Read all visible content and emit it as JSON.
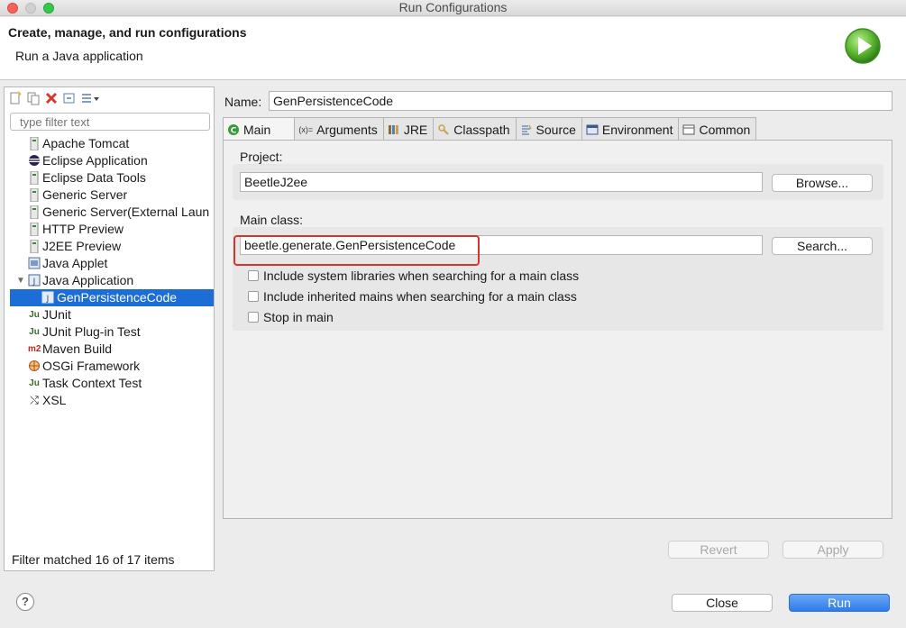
{
  "window": {
    "title": "Run Configurations"
  },
  "header": {
    "title": "Create, manage, and run configurations",
    "subtitle": "Run a Java application"
  },
  "left": {
    "filter_placeholder": "type filter text",
    "items": [
      {
        "label": "Apache Tomcat",
        "icon": "tomcat-icon"
      },
      {
        "label": "Eclipse Application",
        "icon": "eclipse-icon"
      },
      {
        "label": "Eclipse Data Tools",
        "icon": "data-tools-icon"
      },
      {
        "label": "Generic Server",
        "icon": "server-icon"
      },
      {
        "label": "Generic Server(External Laun",
        "icon": "server-icon"
      },
      {
        "label": "HTTP Preview",
        "icon": "server-icon"
      },
      {
        "label": "J2EE Preview",
        "icon": "server-icon"
      },
      {
        "label": "Java Applet",
        "icon": "applet-icon"
      },
      {
        "label": "Java Application",
        "icon": "java-app-icon"
      },
      {
        "label": "GenPersistenceCode",
        "icon": "java-app-icon"
      },
      {
        "label": "JUnit",
        "icon": "junit-icon"
      },
      {
        "label": "JUnit Plug-in Test",
        "icon": "junit-plugin-icon"
      },
      {
        "label": "Maven Build",
        "icon": "maven-icon"
      },
      {
        "label": "OSGi Framework",
        "icon": "osgi-icon"
      },
      {
        "label": "Task Context Test",
        "icon": "junit-icon"
      },
      {
        "label": "XSL",
        "icon": "xsl-icon"
      }
    ],
    "filter_status": "Filter matched 16 of 17 items"
  },
  "right": {
    "name_label": "Name:",
    "name_value": "GenPersistenceCode",
    "tabs": [
      {
        "label": "Main",
        "icon": "main-tab-icon"
      },
      {
        "label": "Arguments",
        "icon": "arguments-icon"
      },
      {
        "label": "JRE",
        "icon": "jre-icon"
      },
      {
        "label": "Classpath",
        "icon": "classpath-icon"
      },
      {
        "label": "Source",
        "icon": "source-icon"
      },
      {
        "label": "Environment",
        "icon": "environment-icon"
      },
      {
        "label": "Common",
        "icon": "common-icon"
      }
    ],
    "project_label": "Project:",
    "project_value": "BeetleJ2ee",
    "browse_label": "Browse...",
    "main_class_label": "Main class:",
    "main_class_value": "beetle.generate.GenPersistenceCode",
    "search_label": "Search...",
    "checks": [
      "Include system libraries when searching for a main class",
      "Include inherited mains when searching for a main class",
      "Stop in main"
    ],
    "revert_label": "Revert",
    "apply_label": "Apply"
  },
  "footer": {
    "help_label": "?",
    "close_label": "Close",
    "run_label": "Run"
  },
  "icons": {
    "args_glyph": "(x)=",
    "junit_glyph": "Ju",
    "maven_glyph": "m2",
    "xsl_glyph": "⤭"
  }
}
